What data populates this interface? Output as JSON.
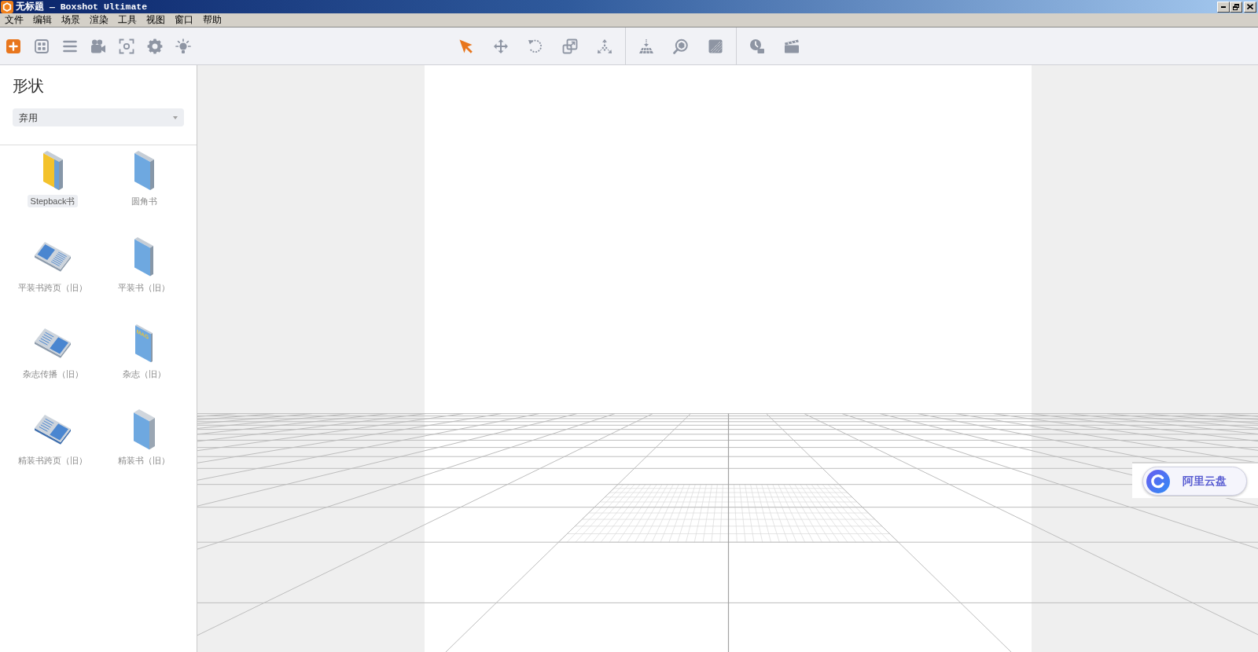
{
  "window": {
    "title": "无标题 — Boxshot Ultimate"
  },
  "menu_bar": [
    "文件",
    "编辑",
    "场景",
    "渲染",
    "工具",
    "视图",
    "窗口",
    "帮助"
  ],
  "toolbar": {
    "panel_buttons": [
      {
        "kind": "add",
        "selected": true
      },
      {
        "kind": "layout",
        "selected": false
      },
      {
        "kind": "list",
        "selected": false
      },
      {
        "kind": "camera",
        "selected": false
      },
      {
        "kind": "capture",
        "selected": false
      },
      {
        "kind": "settings",
        "selected": false
      },
      {
        "kind": "light",
        "selected": false
      }
    ],
    "tool_groups": [
      [
        {
          "kind": "select",
          "selected": true
        },
        {
          "kind": "move",
          "selected": false
        },
        {
          "kind": "rotate",
          "selected": false
        },
        {
          "kind": "scale",
          "selected": false
        },
        {
          "kind": "explode",
          "selected": false
        }
      ],
      [
        {
          "kind": "ground",
          "selected": false
        },
        {
          "kind": "view",
          "selected": false
        },
        {
          "kind": "shadow",
          "selected": false
        }
      ],
      [
        {
          "kind": "render",
          "selected": false
        },
        {
          "kind": "animate",
          "selected": false
        }
      ]
    ]
  },
  "sidebar": {
    "title": "形状",
    "category": {
      "value": "弃用"
    },
    "shapes": [
      {
        "kind": "stepback",
        "label": "Stepback书",
        "selected": true
      },
      {
        "kind": "rounded",
        "label": "圆角书",
        "selected": false
      },
      {
        "kind": "spread",
        "label": "平装书跨页（旧）",
        "selected": false
      },
      {
        "kind": "paperback",
        "label": "平装书（旧）",
        "selected": false
      },
      {
        "kind": "magspread",
        "label": "杂志传播（旧）",
        "selected": false
      },
      {
        "kind": "magazine",
        "label": "杂志（旧）",
        "selected": false,
        "cover_text": "MAG"
      },
      {
        "kind": "hardspread",
        "label": "精装书跨页（旧）",
        "selected": false
      },
      {
        "kind": "hardcover",
        "label": "精装书（旧）",
        "selected": false
      }
    ]
  },
  "viewport": {
    "floating_widget": {
      "label": "阿里云盘"
    }
  }
}
